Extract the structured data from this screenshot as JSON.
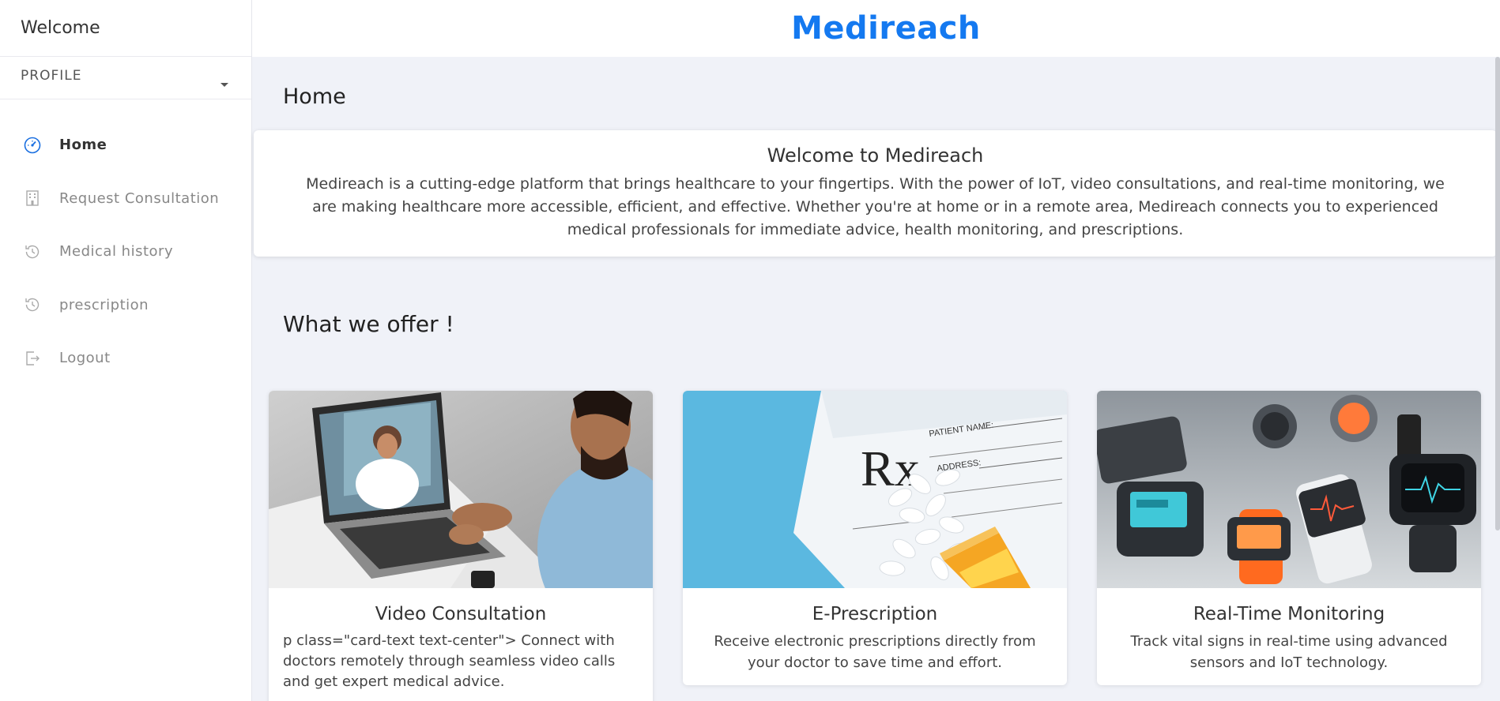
{
  "sidebar": {
    "welcome": "Welcome",
    "profile": "PROFILE",
    "items": [
      {
        "label": "Home",
        "icon": "dashboard-gauge-icon",
        "active": true
      },
      {
        "label": "Request Consultation",
        "icon": "hospital-building-icon",
        "active": false
      },
      {
        "label": "Medical history",
        "icon": "history-clock-icon",
        "active": false
      },
      {
        "label": "prescription",
        "icon": "history-clock-icon",
        "active": false
      },
      {
        "label": "Logout",
        "icon": "logout-icon",
        "active": false
      }
    ]
  },
  "header": {
    "brand": "Medireach"
  },
  "main": {
    "page_title": "Home",
    "welcome": {
      "title": "Welcome to Medireach",
      "text": "Medireach is a cutting-edge platform that brings healthcare to your fingertips. With the power of IoT, video consultations, and real-time monitoring, we are making healthcare more accessible, efficient, and effective. Whether you're at home or in a remote area, Medireach connects you to experienced medical professionals for immediate advice, health monitoring, and prescriptions."
    },
    "offer_title": "What we offer !",
    "cards": [
      {
        "title": "Video Consultation",
        "text": "p class=\"card-text text-center\"> Connect with doctors remotely through seamless video calls and get expert medical advice."
      },
      {
        "title": "E-Prescription",
        "text": "Receive electronic prescriptions directly from your doctor to save time and effort."
      },
      {
        "title": "Real-Time Monitoring",
        "text": "Track vital signs in real-time using advanced sensors and IoT technology."
      }
    ],
    "rx_labels": {
      "patient": "PATIENT NAME:",
      "address": "ADDRESS:",
      "rx": "Rx"
    }
  },
  "colors": {
    "brand": "#1479f0",
    "active_icon": "#1a6fe0",
    "background": "#f0f2f8"
  }
}
